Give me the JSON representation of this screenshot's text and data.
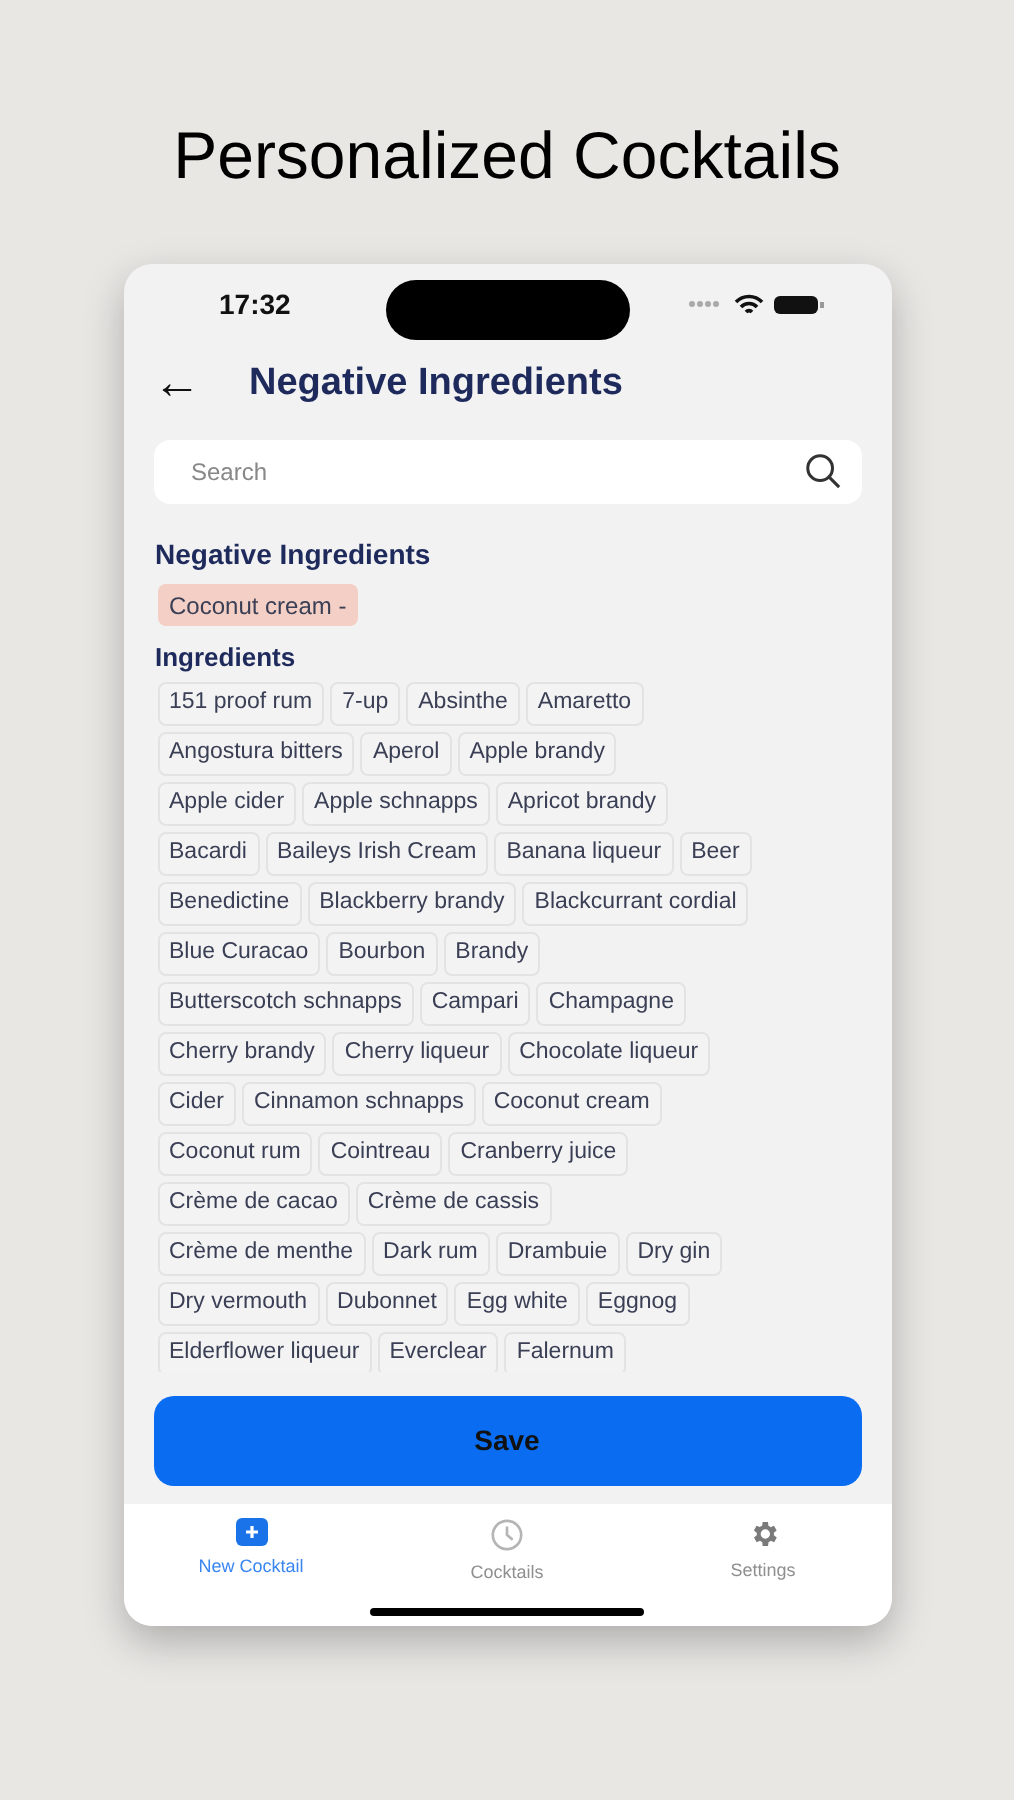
{
  "headline": "Personalized Cocktails",
  "status_bar": {
    "time": "17:32"
  },
  "header": {
    "back": "←",
    "title": "Negative Ingredients"
  },
  "search": {
    "placeholder": "Search"
  },
  "negative_section": {
    "title": "Negative Ingredients",
    "items": [
      "Coconut cream -"
    ]
  },
  "ingredients_section": {
    "title": "Ingredients",
    "rows": [
      [
        "151 proof rum",
        "7-up",
        "Absinthe",
        "Amaretto"
      ],
      [
        "Angostura bitters",
        "Aperol",
        "Apple brandy"
      ],
      [
        "Apple cider",
        "Apple schnapps",
        "Apricot brandy"
      ],
      [
        "Bacardi",
        "Baileys Irish Cream",
        "Banana liqueur",
        "Beer"
      ],
      [
        "Benedictine",
        "Blackberry brandy",
        "Blackcurrant cordial"
      ],
      [
        "Blue Curacao",
        "Bourbon",
        "Brandy"
      ],
      [
        "Butterscotch schnapps",
        "Campari",
        "Champagne"
      ],
      [
        "Cherry brandy",
        "Cherry liqueur",
        "Chocolate liqueur"
      ],
      [
        "Cider",
        "Cinnamon schnapps",
        "Coconut cream"
      ],
      [
        "Coconut rum",
        "Cointreau",
        "Cranberry juice"
      ],
      [
        "Crème de cacao",
        "Crème de cassis"
      ],
      [
        "Crème de menthe",
        "Dark rum",
        "Drambuie",
        "Dry gin"
      ],
      [
        "Dry vermouth",
        "Dubonnet",
        "Egg white",
        "Eggnog"
      ],
      [
        "Elderflower liqueur",
        "Everclear",
        "Falernum"
      ]
    ]
  },
  "save_button": "Save",
  "tabs": [
    {
      "label": "New Cocktail",
      "kind": "plus",
      "selected": true
    },
    {
      "label": "Cocktails",
      "kind": "clock",
      "selected": false
    },
    {
      "label": "Settings",
      "kind": "gear",
      "selected": false
    }
  ]
}
